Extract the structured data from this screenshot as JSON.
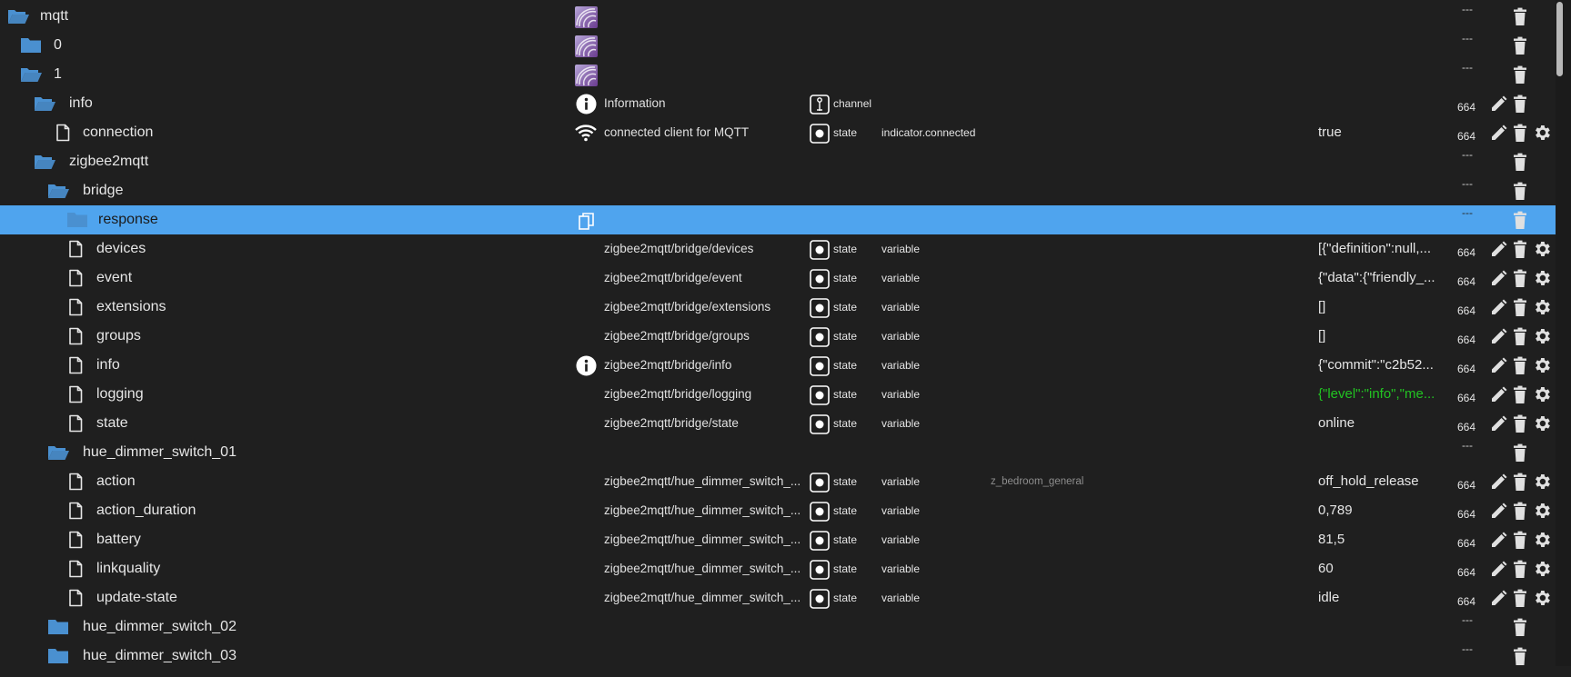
{
  "colors": {
    "background": "#1f1f1f",
    "selected_row": "#4fa4ee",
    "folder": "#4a90d0",
    "value_green": "#22c322"
  },
  "dash": "---",
  "rows": [
    {
      "name": "mqtt",
      "depth": 0,
      "icon": "folder-open-icon",
      "kind": "instance",
      "descr": "",
      "role_icon": "",
      "role": "",
      "type": "",
      "room": "",
      "value": "",
      "acl": "",
      "dash": true,
      "gear": false
    },
    {
      "name": "0",
      "depth": 1,
      "icon": "folder-icon",
      "kind": "instance",
      "descr": "",
      "role_icon": "",
      "role": "",
      "type": "",
      "room": "",
      "value": "",
      "acl": "",
      "dash": true,
      "gear": false
    },
    {
      "name": "1",
      "depth": 1,
      "icon": "folder-open-icon",
      "kind": "instance",
      "descr": "",
      "role_icon": "",
      "role": "",
      "type": "",
      "room": "",
      "value": "",
      "acl": "",
      "dash": true,
      "gear": false
    },
    {
      "name": "info",
      "depth": 2,
      "icon": "folder-open-icon",
      "kind": "info",
      "descr": "Information",
      "role_icon": "channel",
      "role": "channel",
      "type": "",
      "room": "",
      "value": "",
      "acl": "664",
      "dash": false,
      "gear": false
    },
    {
      "name": "connection",
      "depth": 3,
      "icon": "file-icon",
      "kind": "wifi",
      "descr": "connected client for MQTT",
      "role_icon": "state",
      "role": "state",
      "type": "indicator.connected",
      "room": "",
      "value": "true",
      "acl": "664",
      "dash": false,
      "gear": true
    },
    {
      "name": "zigbee2mqtt",
      "depth": 2,
      "icon": "folder-open-icon",
      "kind": "",
      "descr": "",
      "role_icon": "",
      "role": "",
      "type": "",
      "room": "",
      "value": "",
      "acl": "",
      "dash": true,
      "gear": false
    },
    {
      "name": "bridge",
      "depth": 3,
      "icon": "folder-open-icon",
      "kind": "",
      "descr": "",
      "role_icon": "",
      "role": "",
      "type": "",
      "room": "",
      "value": "",
      "acl": "",
      "dash": true,
      "gear": false
    },
    {
      "name": "response",
      "depth": 4,
      "icon": "folder-icon",
      "kind": "copy",
      "descr": "",
      "role_icon": "",
      "role": "",
      "type": "",
      "room": "",
      "value": "",
      "acl": "",
      "dash": true,
      "gear": false,
      "selected": true
    },
    {
      "name": "devices",
      "depth": 4,
      "icon": "file-icon",
      "kind": "",
      "descr": "zigbee2mqtt/bridge/devices",
      "role_icon": "state",
      "role": "state",
      "type": "variable",
      "room": "",
      "value": "[{\"definition\":null,...",
      "acl": "664",
      "dash": false,
      "gear": true
    },
    {
      "name": "event",
      "depth": 4,
      "icon": "file-icon",
      "kind": "",
      "descr": "zigbee2mqtt/bridge/event",
      "role_icon": "state",
      "role": "state",
      "type": "variable",
      "room": "",
      "value": "{\"data\":{\"friendly_...",
      "acl": "664",
      "dash": false,
      "gear": true
    },
    {
      "name": "extensions",
      "depth": 4,
      "icon": "file-icon",
      "kind": "",
      "descr": "zigbee2mqtt/bridge/extensions",
      "role_icon": "state",
      "role": "state",
      "type": "variable",
      "room": "",
      "value": "[]",
      "acl": "664",
      "dash": false,
      "gear": true
    },
    {
      "name": "groups",
      "depth": 4,
      "icon": "file-icon",
      "kind": "",
      "descr": "zigbee2mqtt/bridge/groups",
      "role_icon": "state",
      "role": "state",
      "type": "variable",
      "room": "",
      "value": "[]",
      "acl": "664",
      "dash": false,
      "gear": true
    },
    {
      "name": "info",
      "depth": 4,
      "icon": "file-icon",
      "kind": "info",
      "descr": "zigbee2mqtt/bridge/info",
      "role_icon": "state",
      "role": "state",
      "type": "variable",
      "room": "",
      "value": "{\"commit\":\"c2b52...",
      "acl": "664",
      "dash": false,
      "gear": true
    },
    {
      "name": "logging",
      "depth": 4,
      "icon": "file-icon",
      "kind": "",
      "descr": "zigbee2mqtt/bridge/logging",
      "role_icon": "state",
      "role": "state",
      "type": "variable",
      "room": "",
      "value": "{\"level\":\"info\",\"me...",
      "value_color": "green",
      "acl": "664",
      "dash": false,
      "gear": true
    },
    {
      "name": "state",
      "depth": 4,
      "icon": "file-icon",
      "kind": "",
      "descr": "zigbee2mqtt/bridge/state",
      "role_icon": "state",
      "role": "state",
      "type": "variable",
      "room": "",
      "value": "online",
      "acl": "664",
      "dash": false,
      "gear": true
    },
    {
      "name": "hue_dimmer_switch_01",
      "depth": 3,
      "icon": "folder-open-icon",
      "kind": "",
      "descr": "",
      "role_icon": "",
      "role": "",
      "type": "",
      "room": "",
      "value": "",
      "acl": "",
      "dash": true,
      "gear": false
    },
    {
      "name": "action",
      "depth": 4,
      "icon": "file-icon",
      "kind": "",
      "descr": "zigbee2mqtt/hue_dimmer_switch_...",
      "role_icon": "state",
      "role": "state",
      "type": "variable",
      "room": "z_bedroom_general",
      "value": "off_hold_release",
      "acl": "664",
      "dash": false,
      "gear": true
    },
    {
      "name": "action_duration",
      "depth": 4,
      "icon": "file-icon",
      "kind": "",
      "descr": "zigbee2mqtt/hue_dimmer_switch_...",
      "role_icon": "state",
      "role": "state",
      "type": "variable",
      "room": "",
      "value": "0,789",
      "acl": "664",
      "dash": false,
      "gear": true
    },
    {
      "name": "battery",
      "depth": 4,
      "icon": "file-icon",
      "kind": "",
      "descr": "zigbee2mqtt/hue_dimmer_switch_...",
      "role_icon": "state",
      "role": "state",
      "type": "variable",
      "room": "",
      "value": "81,5",
      "acl": "664",
      "dash": false,
      "gear": true
    },
    {
      "name": "linkquality",
      "depth": 4,
      "icon": "file-icon",
      "kind": "",
      "descr": "zigbee2mqtt/hue_dimmer_switch_...",
      "role_icon": "state",
      "role": "state",
      "type": "variable",
      "room": "",
      "value": "60",
      "acl": "664",
      "dash": false,
      "gear": true
    },
    {
      "name": "update-state",
      "depth": 4,
      "icon": "file-icon",
      "kind": "",
      "descr": "zigbee2mqtt/hue_dimmer_switch_...",
      "role_icon": "state",
      "role": "state",
      "type": "variable",
      "room": "",
      "value": "idle",
      "acl": "664",
      "dash": false,
      "gear": true
    },
    {
      "name": "hue_dimmer_switch_02",
      "depth": 3,
      "icon": "folder-icon",
      "kind": "",
      "descr": "",
      "role_icon": "",
      "role": "",
      "type": "",
      "room": "",
      "value": "",
      "acl": "",
      "dash": true,
      "gear": false
    },
    {
      "name": "hue_dimmer_switch_03",
      "depth": 3,
      "icon": "folder-icon",
      "kind": "",
      "descr": "",
      "role_icon": "",
      "role": "",
      "type": "",
      "room": "",
      "value": "",
      "acl": "",
      "dash": true,
      "gear": false
    }
  ]
}
